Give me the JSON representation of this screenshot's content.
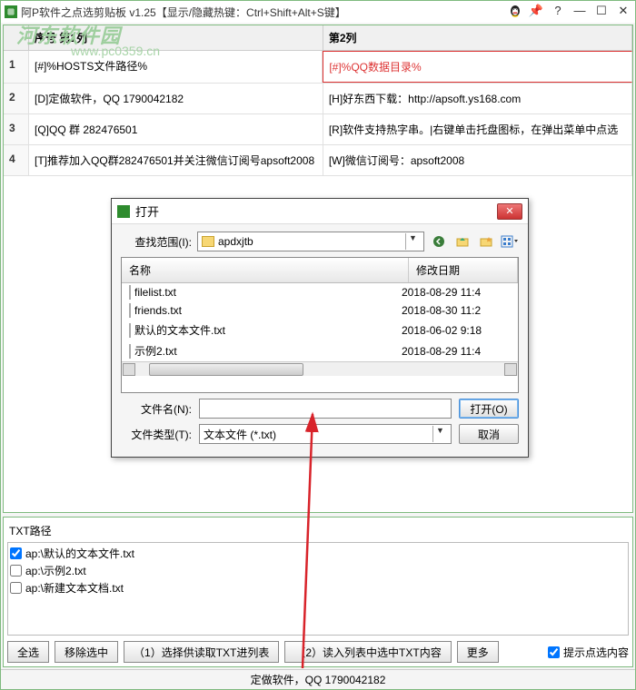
{
  "title": "阿P软件之点选剪贴板 v1.25【显示/隐藏热键：Ctrl+Shift+Alt+S键】",
  "watermark": {
    "title": "河东软件园",
    "url": "www.pc0359.cn"
  },
  "grid": {
    "col1_header": "序号 第1列",
    "col2_header": "第2列",
    "rows": [
      {
        "n": "1",
        "c1": "[#]%HOSTS文件路径%",
        "c2": "[#]%QQ数据目录%"
      },
      {
        "n": "2",
        "c1": "[D]定做软件，QQ 1790042182",
        "c2": "[H]好东西下载：http://apsoft.ys168.com"
      },
      {
        "n": "3",
        "c1": "[Q]QQ 群 282476501",
        "c2": "[R]软件支持热字串。|右键单击托盘图标，在弹出菜单中点选"
      },
      {
        "n": "4",
        "c1": "[T]推荐加入QQ群282476501并关注微信订阅号apsoft2008",
        "c2": "[W]微信订阅号：apsoft2008"
      }
    ]
  },
  "dialog": {
    "title": "打开",
    "look_in_label": "查找范围(I):",
    "folder": "apdxjtb",
    "cols": {
      "name": "名称",
      "date": "修改日期"
    },
    "files": [
      {
        "name": "filelist.txt",
        "date": "2018-08-29 11:4"
      },
      {
        "name": "friends.txt",
        "date": "2018-08-30 11:2"
      },
      {
        "name": "默认的文本文件.txt",
        "date": "2018-06-02 9:18"
      },
      {
        "name": "示例2.txt",
        "date": "2018-08-29 11:4"
      }
    ],
    "filename_label": "文件名(N):",
    "filename_value": "",
    "filetype_label": "文件类型(T):",
    "filetype_value": "文本文件 (*.txt)",
    "open_btn": "打开(O)",
    "cancel_btn": "取消"
  },
  "bottom": {
    "label": "TXT路径",
    "items": [
      {
        "checked": true,
        "text": "ap:\\默认的文本文件.txt"
      },
      {
        "checked": false,
        "text": "ap:\\示例2.txt"
      },
      {
        "checked": false,
        "text": "ap:\\新建文本文档.txt"
      }
    ],
    "btn_all": "全选",
    "btn_remove": "移除选中",
    "btn_step1": "（1）选择供读取TXT进列表",
    "btn_step2": "（2）读入列表中选中TXT内容",
    "btn_more": "更多",
    "hint": "提示点选内容"
  },
  "status": "定做软件，QQ 1790042182"
}
